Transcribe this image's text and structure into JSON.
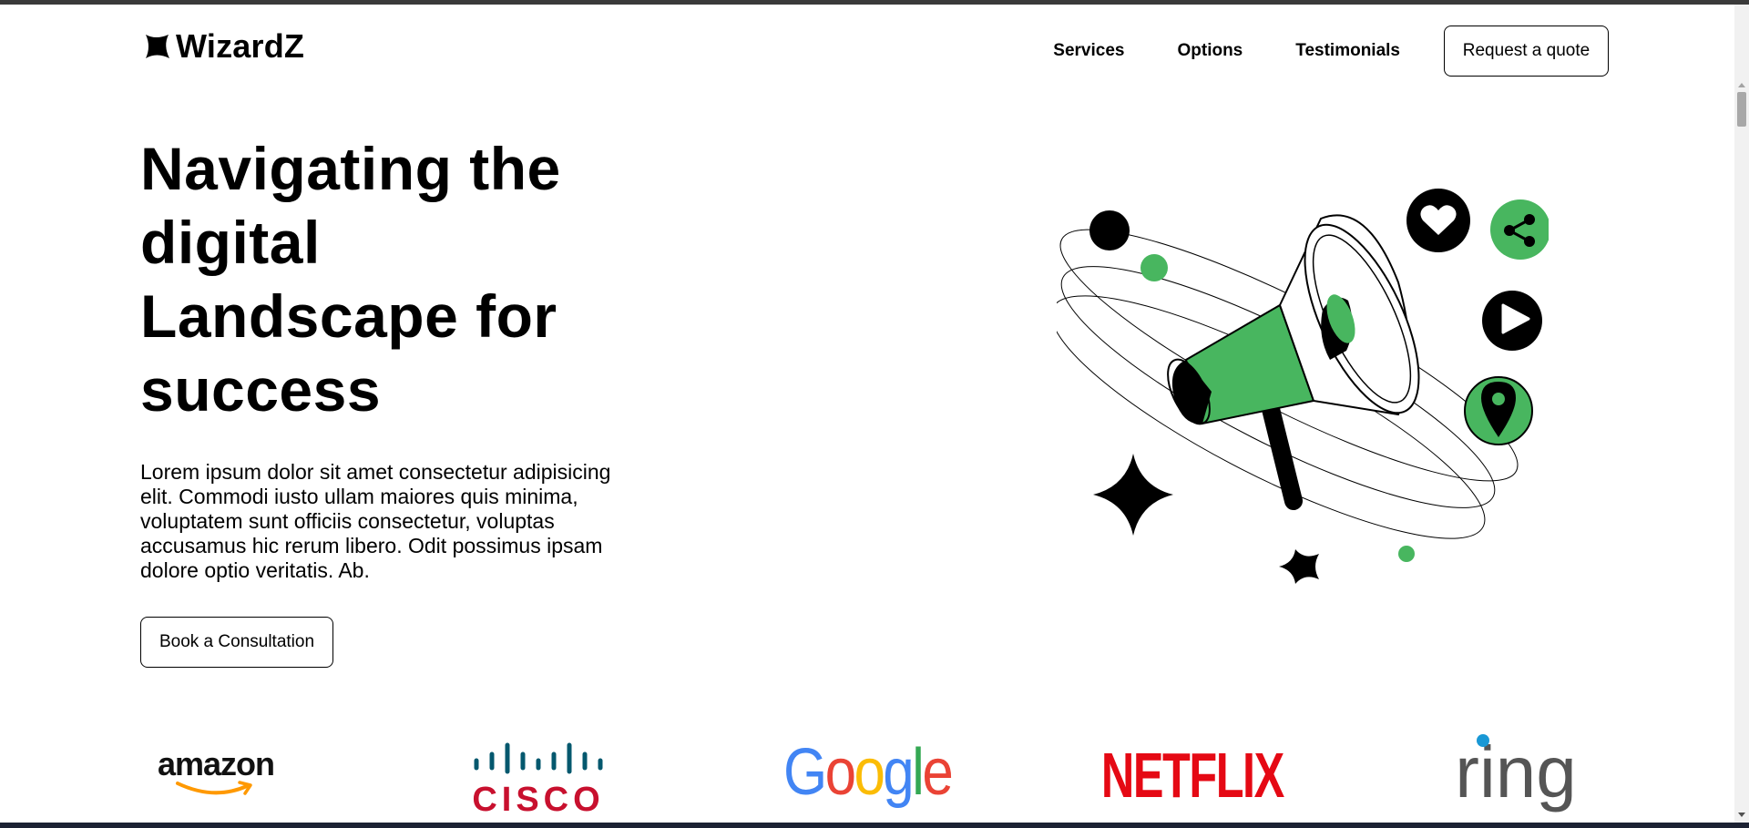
{
  "header": {
    "logo_text": "WizardZ",
    "nav": [
      {
        "label": "Services"
      },
      {
        "label": "Options"
      },
      {
        "label": "Testimonials"
      }
    ],
    "quote_button": "Request a quote"
  },
  "hero": {
    "title": "Navigating the digital Landscape for success",
    "description": "Lorem ipsum dolor sit amet consectetur adipisicing elit. Commodi iusto ullam maiores quis minima, voluptatem sunt officiis consectetur, voluptas accusamus hic rerum libero. Odit possimus ipsam dolore optio veritatis. Ab.",
    "cta_button": "Book a Consultation"
  },
  "brands": {
    "amazon": "amazon",
    "cisco": "CISCO",
    "google": "Google",
    "netflix": "NETFLIX",
    "ring": "ring"
  },
  "colors": {
    "accent_green": "#48b65f",
    "text": "#000000",
    "netflix_red": "#e50914",
    "amazon_orange": "#ff9900",
    "cisco_teal": "#04586e",
    "cisco_red": "#c8102e",
    "google_blue": "#4285f4",
    "google_red": "#ea4335",
    "google_yellow": "#fbbc05",
    "google_green": "#34a853",
    "ring_gray": "#555555",
    "ring_blue": "#1998d5"
  },
  "icons": {
    "logo": "four-point-star-icon",
    "illustration": [
      "megaphone-icon",
      "heart-icon",
      "share-icon",
      "play-icon",
      "location-pin-icon",
      "sparkle-star-icon"
    ]
  }
}
